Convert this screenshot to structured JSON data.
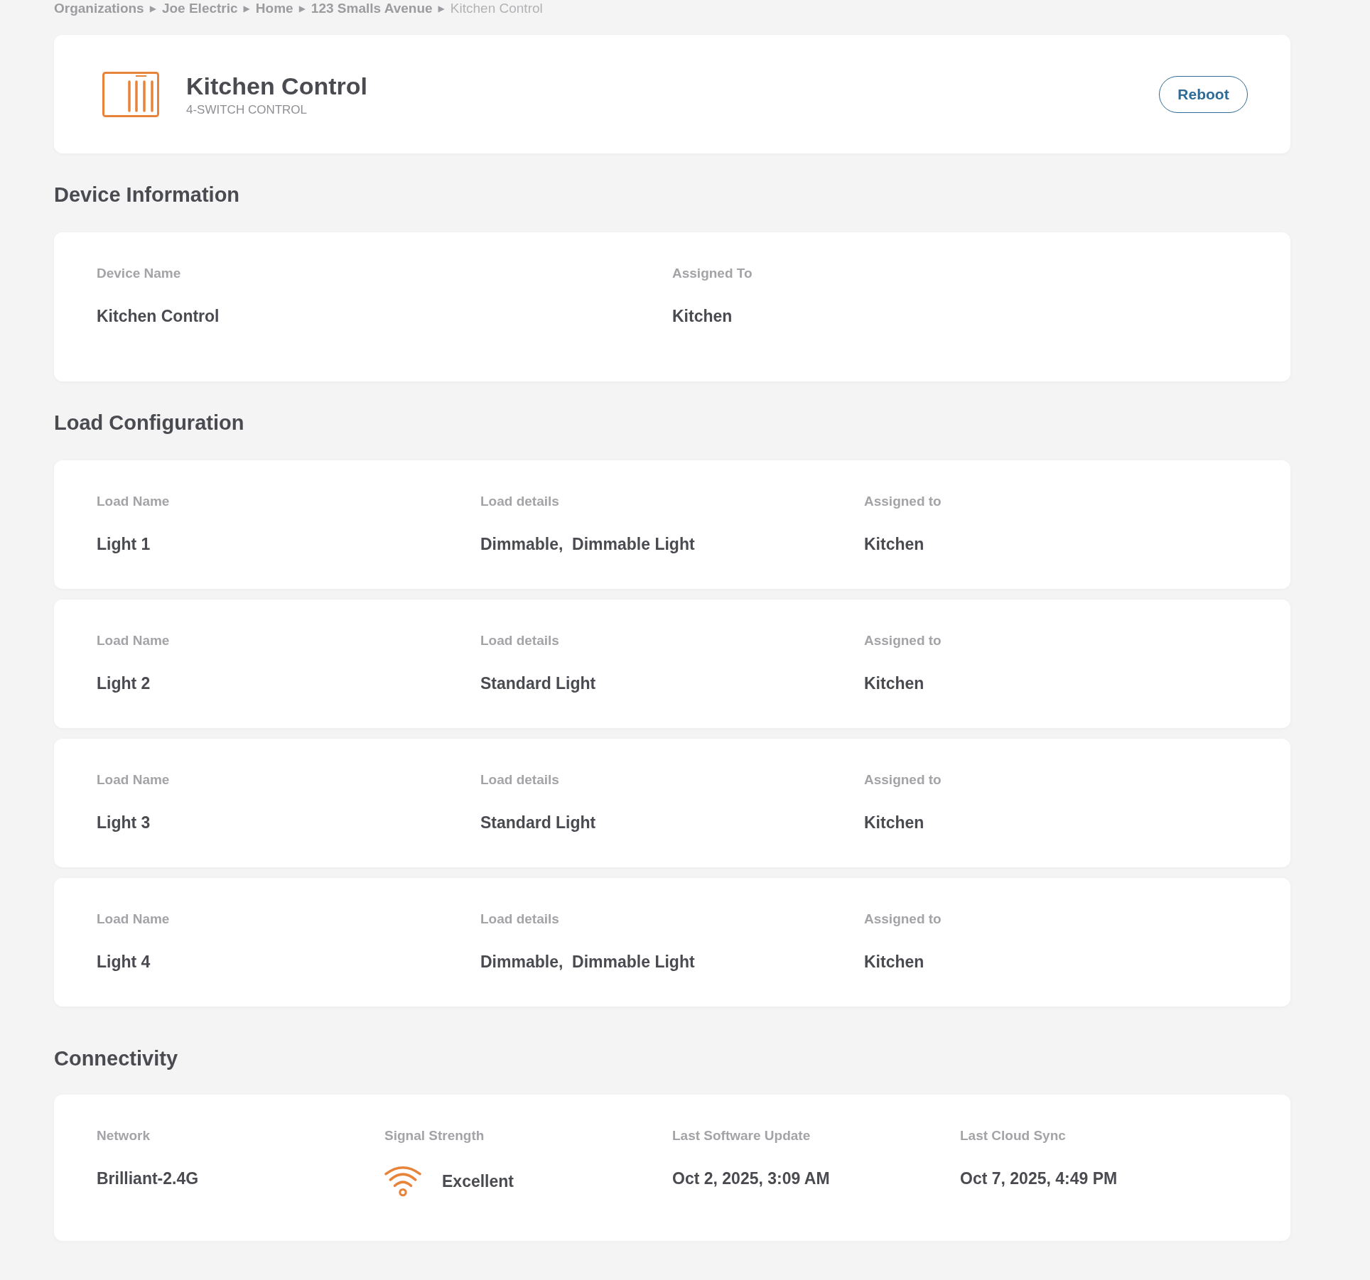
{
  "breadcrumb": [
    {
      "kind": "link",
      "label": "Organizations"
    },
    {
      "kind": "separator",
      "label": "▶"
    },
    {
      "kind": "link",
      "label": "Joe Electric"
    },
    {
      "kind": "separator",
      "label": "▶"
    },
    {
      "kind": "link",
      "label": "Home"
    },
    {
      "kind": "separator",
      "label": "▶"
    },
    {
      "kind": "link",
      "label": "123 Smalls Avenue"
    },
    {
      "kind": "separator",
      "label": "▶"
    },
    {
      "kind": "current",
      "label": "Kitchen Control"
    }
  ],
  "device_header": {
    "title": "Kitchen Control",
    "subtitle": "4-SWITCH CONTROL",
    "button": "Reboot"
  },
  "device_information": {
    "heading": "Device Information",
    "fields": [
      {
        "label": "Device Name",
        "value": "Kitchen Control"
      },
      {
        "label": "Assigned To",
        "value": "Kitchen"
      }
    ]
  },
  "load_configuration": {
    "heading": "Load Configuration",
    "loads": [
      {
        "fields": [
          {
            "label": "Load Name",
            "value": "Light 1"
          },
          {
            "label": "Load details",
            "value": "Dimmable,  Dimmable Light"
          },
          {
            "label": "Assigned to",
            "value": "Kitchen"
          }
        ]
      },
      {
        "fields": [
          {
            "label": "Load Name",
            "value": "Light 2"
          },
          {
            "label": "Load details",
            "value": "Standard Light"
          },
          {
            "label": "Assigned to",
            "value": "Kitchen"
          }
        ]
      },
      {
        "fields": [
          {
            "label": "Load Name",
            "value": "Light 3"
          },
          {
            "label": "Load details",
            "value": "Standard Light"
          },
          {
            "label": "Assigned to",
            "value": "Kitchen"
          }
        ]
      },
      {
        "fields": [
          {
            "label": "Load Name",
            "value": "Light 4"
          },
          {
            "label": "Load details",
            "value": "Dimmable,  Dimmable Light"
          },
          {
            "label": "Assigned to",
            "value": "Kitchen"
          }
        ]
      }
    ]
  },
  "connectivity": {
    "heading": "Connectivity",
    "fields": [
      {
        "kind": "text",
        "label": "Network",
        "value": "Brilliant-2.4G"
      },
      {
        "kind": "signal",
        "label": "Signal Strength",
        "value": "Excellent"
      },
      {
        "kind": "text",
        "label": "Last Software Update",
        "value": "Oct 2, 2025, 3:09 AM"
      },
      {
        "kind": "text",
        "label": "Last Cloud Sync",
        "value": "Oct 7, 2025, 4:49 PM"
      }
    ]
  }
}
